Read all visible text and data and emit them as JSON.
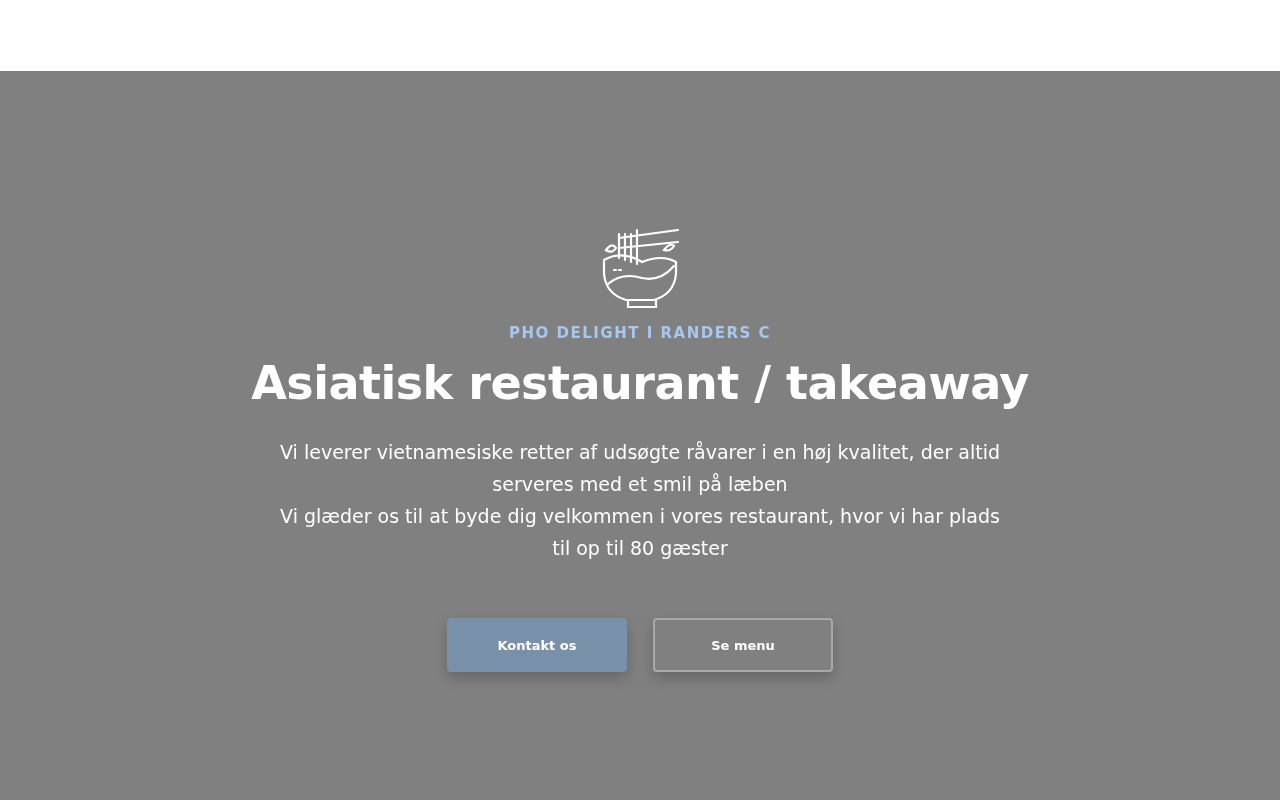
{
  "hero": {
    "eyebrow": "PHO DELIGHT I RANDERS C",
    "heading": "Asiatisk restaurant / takeaway",
    "paragraphs": [
      "Vi leverer vietnamesiske retter af udsøgte råvarer i en høj kvalitet, der altid serveres med et smil på læben",
      "Vi glæder os til at byde dig velkommen i vores restaurant, hvor vi har plads til op til 80 gæster"
    ],
    "buttons": [
      {
        "label": "Kontakt os",
        "kind": "primary"
      },
      {
        "label": "Se menu",
        "kind": "outline"
      }
    ]
  }
}
